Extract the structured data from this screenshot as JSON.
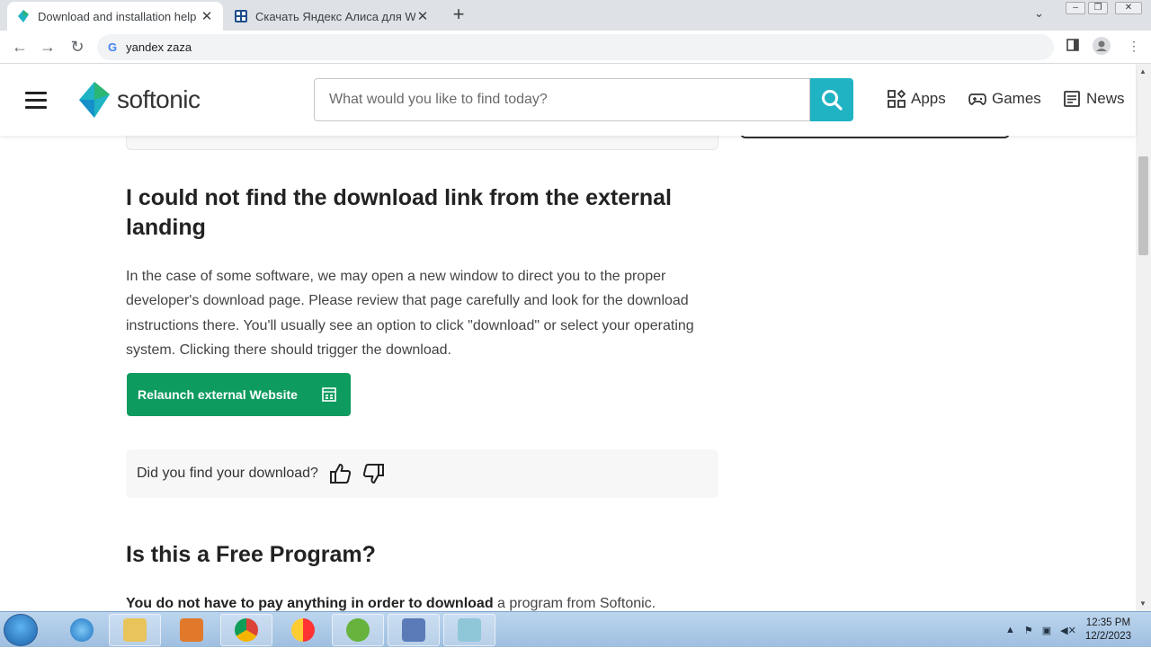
{
  "browser": {
    "tabs": [
      {
        "title": "Download and installation help",
        "active": true
      },
      {
        "title": "Скачать Яндекс Алиса для Windows",
        "active": false
      }
    ],
    "address": "yandex zaza"
  },
  "header": {
    "logo_text": "softonic",
    "search_placeholder": "What would you like to find today?",
    "nav": [
      "Apps",
      "Games",
      "News"
    ]
  },
  "article": {
    "heading": "I could not find the download link from the external landing",
    "paragraph": "In the case of some software, we may open a new window to direct you to the proper developer's download page. Please review that page carefully and look for the download instructions there. You'll usually see an option to click \"download\" or select your operating system. Clicking there should trigger the download.",
    "relaunch_label": "Relaunch external Website",
    "feedback_question": "Did you find your download?",
    "heading2": "Is this a Free Program?",
    "paragraph2_bold": "You do not have to pay anything in order to download",
    "paragraph2_rest": " a program from Softonic."
  },
  "taskbar": {
    "time": "12:35 PM",
    "date": "12/2/2023"
  },
  "colors": {
    "brand_teal": "#1fb3c3",
    "relaunch_green": "#0e9b5f"
  }
}
